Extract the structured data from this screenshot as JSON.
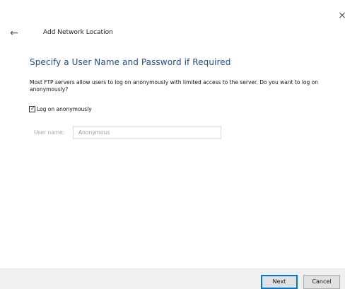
{
  "window": {
    "title": "Add Network Location",
    "close_glyph": "×",
    "back_glyph": "←"
  },
  "main": {
    "heading": "Specify a User Name and Password if Required",
    "description": "Most FTP servers allow users to log on anonymously with limited access to the server.  Do you want to log on anonymously?",
    "anonymous_checkbox": {
      "label": "Log on anonymously",
      "checked": true,
      "check_glyph": "✓"
    },
    "user_name": {
      "label": "User name:",
      "value": "Anonymous",
      "enabled": false
    }
  },
  "footer": {
    "next_label": "Next",
    "cancel_label": "Cancel"
  },
  "colors": {
    "heading": "#1f4e8c",
    "accent": "#0078d7",
    "footer_bg": "#f0f0f0"
  },
  "icons": {
    "close": "close-icon",
    "back": "back-arrow-icon",
    "check": "checkmark-icon"
  }
}
